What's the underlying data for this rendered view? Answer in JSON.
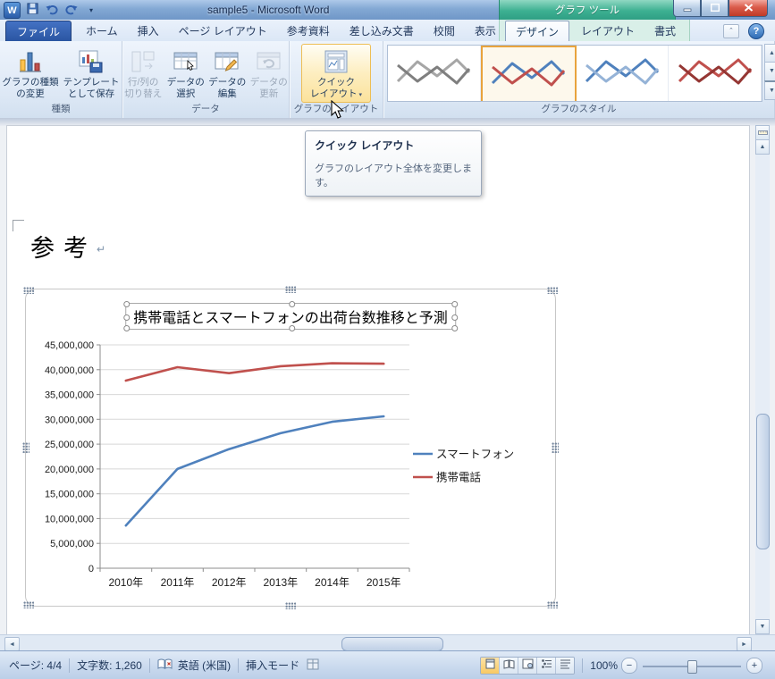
{
  "window": {
    "title": "sample5 - Microsoft Word",
    "contextual_tool_label": "グラフ ツール"
  },
  "icons": {
    "word_logo": "W",
    "help": "?",
    "dropdown": "▾",
    "minimize_ribbon": "ˆ",
    "paragraph_mark": "↵",
    "scroll_up": "▲",
    "scroll_down": "▼",
    "scroll_left": "◄",
    "scroll_right": "►",
    "zoom_in": "+",
    "zoom_out": "−"
  },
  "tabs": {
    "file": "ファイル",
    "items": [
      "ホーム",
      "挿入",
      "ページ レイアウト",
      "参考資料",
      "差し込み文書",
      "校閲",
      "表示"
    ],
    "contextual": [
      "デザイン",
      "レイアウト",
      "書式"
    ],
    "active_tab": "デザイン"
  },
  "ribbon": {
    "groups": [
      {
        "label": "種類",
        "buttons": [
          {
            "lines": [
              "グラフの種類",
              "の変更"
            ],
            "disabled": false
          },
          {
            "lines": [
              "テンプレート",
              "として保存"
            ],
            "disabled": false
          }
        ]
      },
      {
        "label": "データ",
        "buttons": [
          {
            "lines": [
              "行/列の",
              "切り替え"
            ],
            "disabled": true
          },
          {
            "lines": [
              "データの",
              "選択"
            ],
            "disabled": false
          },
          {
            "lines": [
              "データの",
              "編集"
            ],
            "disabled": false
          },
          {
            "lines": [
              "データの",
              "更新"
            ],
            "disabled": true
          }
        ]
      },
      {
        "label": "グラフのレイアウト",
        "buttons": [
          {
            "lines": [
              "クイック",
              "レイアウト"
            ],
            "disabled": false,
            "hovered": true,
            "has_dropdown": true
          }
        ]
      },
      {
        "label": "グラフのスタイル",
        "thumbnails": [
          {
            "name": "gray",
            "colors": [
              "#a6a6a6",
              "#7f7f7f"
            ],
            "selected": false
          },
          {
            "name": "blue-red",
            "colors": [
              "#4f81bd",
              "#c0504d"
            ],
            "selected": true
          },
          {
            "name": "blue",
            "colors": [
              "#4f81bd",
              "#95b3d7"
            ],
            "selected": false
          },
          {
            "name": "red",
            "colors": [
              "#c0504d",
              "#953734"
            ],
            "selected": false
          }
        ]
      }
    ]
  },
  "tooltip": {
    "title": "クイック レイアウト",
    "body": "グラフのレイアウト全体を変更します。"
  },
  "document": {
    "heading": "参考",
    "chart": {
      "chart_data": {
        "type": "line",
        "title": "携帯電話とスマートフォンの出荷台数推移と予測",
        "categories": [
          "2010年",
          "2011年",
          "2012年",
          "2013年",
          "2014年",
          "2015年"
        ],
        "series": [
          {
            "name": "スマートフォン",
            "color": "#4f81bd",
            "values": [
              8600000,
              20000000,
              24000000,
              27200000,
              29500000,
              30600000
            ]
          },
          {
            "name": "携帯電話",
            "color": "#c0504d",
            "values": [
              37800000,
              40500000,
              39300000,
              40700000,
              41300000,
              41200000
            ]
          }
        ],
        "ylim": [
          0,
          45000000
        ],
        "ytick_step": 5000000,
        "grid": true,
        "legend_position": "right"
      }
    }
  },
  "status_bar": {
    "page": "ページ: 4/4",
    "word_count": "文字数: 1,260",
    "language": "英語 (米国)",
    "input_mode": "挿入モード",
    "zoom_level": "100%"
  }
}
